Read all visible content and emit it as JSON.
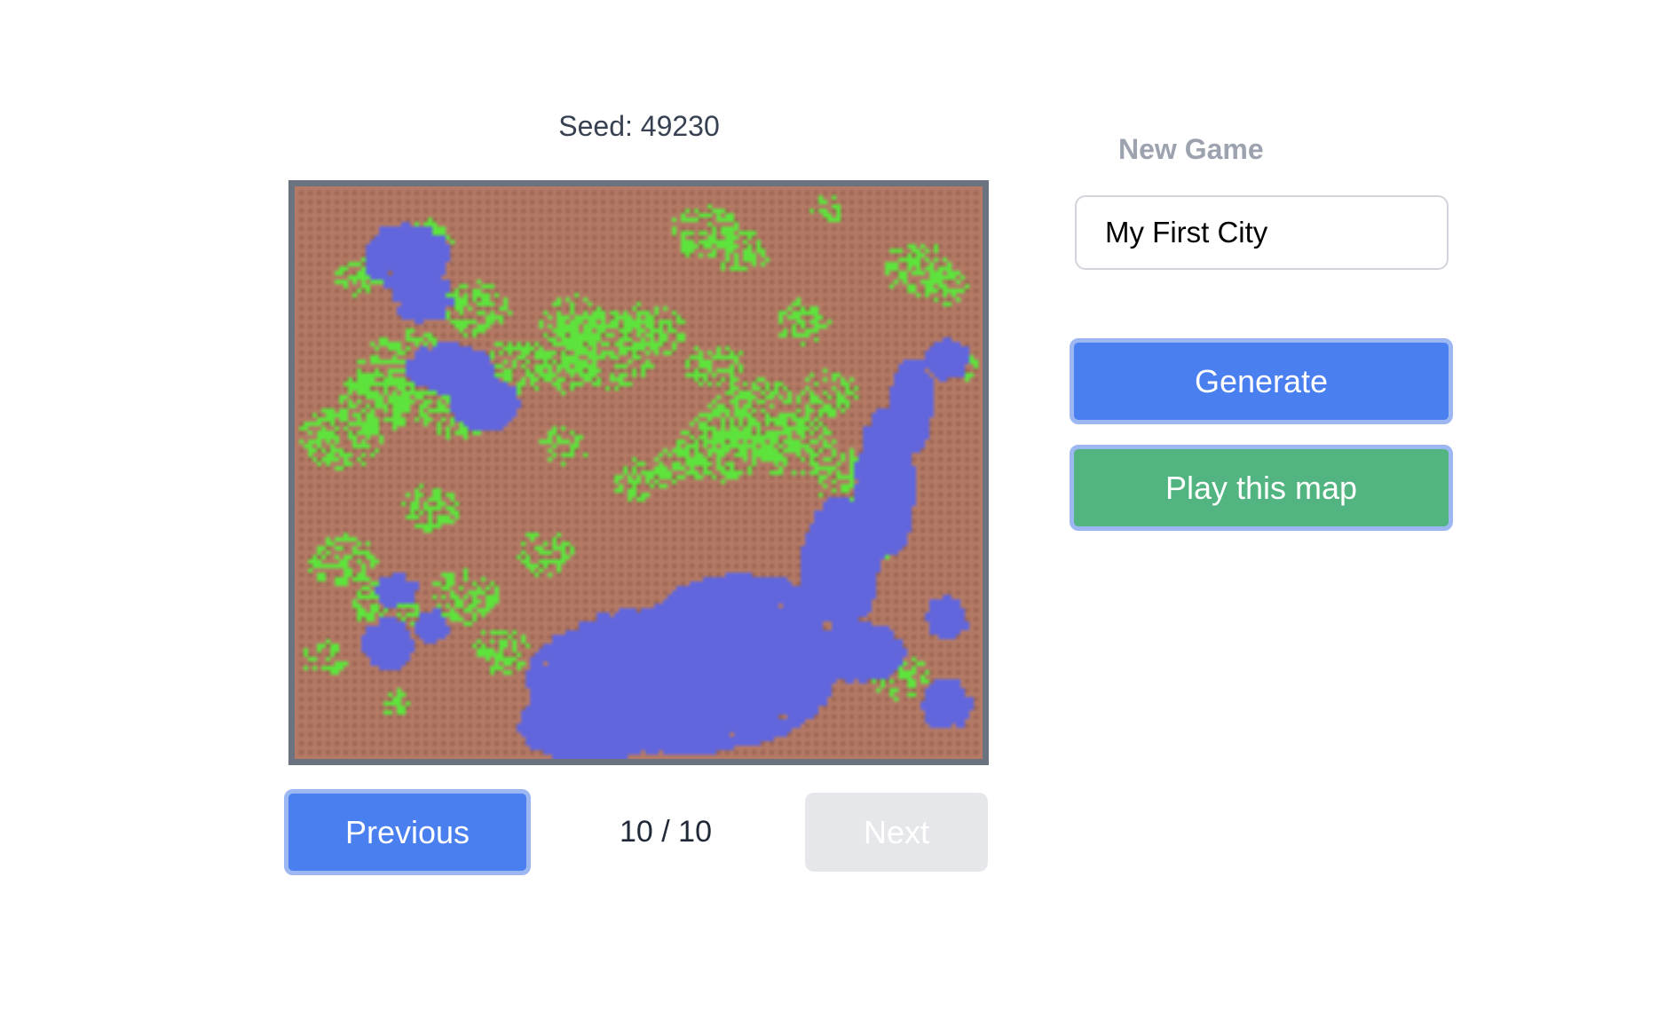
{
  "seed": {
    "label": "Seed: 49230",
    "value": 49230
  },
  "map": {
    "colors": {
      "land": "#b47a66",
      "grass": "#5ee33c",
      "water": "#6266dd",
      "frame": "#6b7280"
    }
  },
  "pager": {
    "previous_label": "Previous",
    "next_label": "Next",
    "indicator": "10 / 10",
    "current": 10,
    "total": 10
  },
  "new_game": {
    "heading": "New Game",
    "city_name_value": "My First City",
    "generate_label": "Generate",
    "play_label": "Play this map"
  },
  "colors": {
    "primary": "#4a7ff0",
    "success": "#52b480",
    "disabled": "#e5e7eb"
  }
}
